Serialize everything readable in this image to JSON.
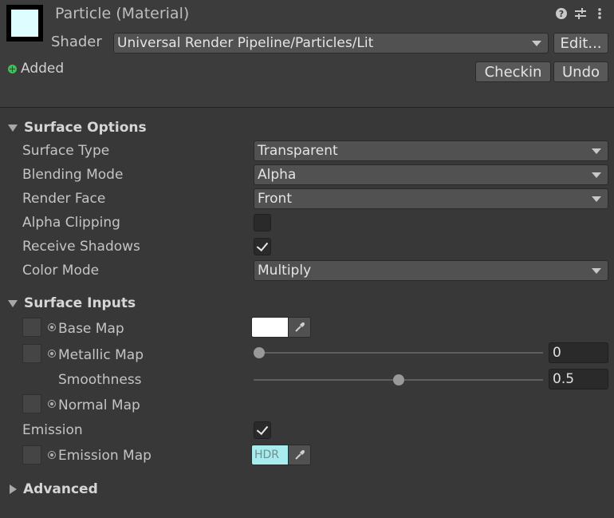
{
  "header": {
    "title": "Particle (Material)",
    "thumbnail_color": "#ddfdff",
    "icons": [
      "help-icon",
      "preset-icon",
      "more-icon"
    ],
    "shader_label": "Shader",
    "shader_value": "Universal Render Pipeline/Particles/Lit",
    "edit_button": "Edit...",
    "vcs_status": "Added",
    "checkin_button": "Checkin",
    "undo_button": "Undo"
  },
  "surface_options": {
    "title": "Surface Options",
    "surface_type": {
      "label": "Surface Type",
      "value": "Transparent"
    },
    "blending_mode": {
      "label": "Blending Mode",
      "value": "Alpha"
    },
    "render_face": {
      "label": "Render Face",
      "value": "Front"
    },
    "alpha_clipping": {
      "label": "Alpha Clipping",
      "checked": false
    },
    "receive_shadows": {
      "label": "Receive Shadows",
      "checked": true
    },
    "color_mode": {
      "label": "Color Mode",
      "value": "Multiply"
    }
  },
  "surface_inputs": {
    "title": "Surface Inputs",
    "base_map": {
      "label": "Base Map",
      "color": "#ffffff"
    },
    "metallic_map": {
      "label": "Metallic Map",
      "value": "0",
      "fraction": 0.0
    },
    "smoothness": {
      "label": "Smoothness",
      "value": "0.5",
      "fraction": 0.5
    },
    "normal_map": {
      "label": "Normal Map"
    },
    "emission": {
      "label": "Emission",
      "checked": true
    },
    "emission_map": {
      "label": "Emission Map",
      "swatch_text": "HDR",
      "color": "#a8ecee"
    }
  },
  "advanced": {
    "title": "Advanced"
  }
}
